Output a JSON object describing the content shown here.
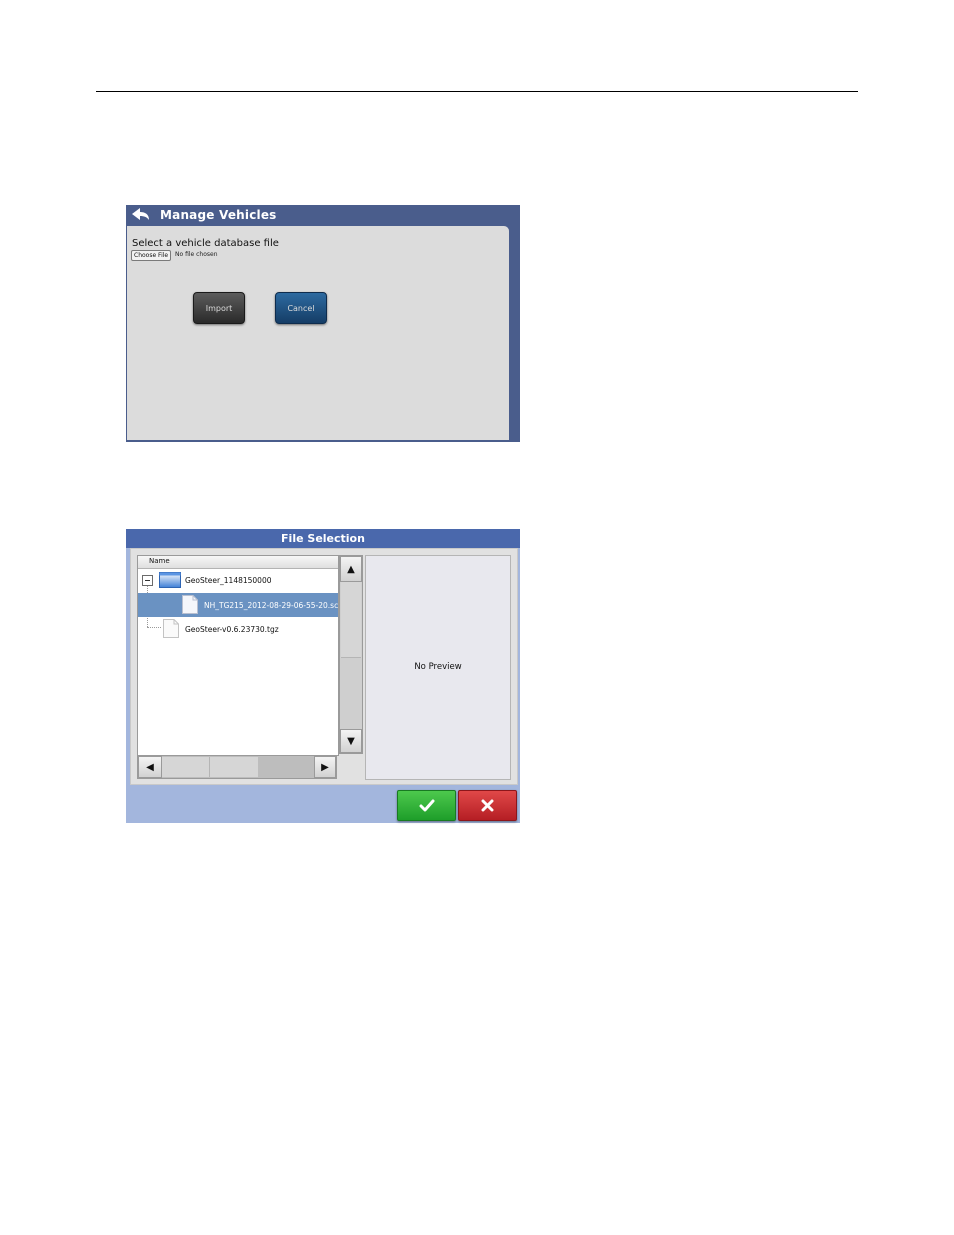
{
  "manage_vehicles": {
    "title": "Manage Vehicles",
    "prompt": "Select a vehicle database file",
    "choose_file_label": "Choose File",
    "file_status": "No file chosen",
    "import_label": "Import",
    "cancel_label": "Cancel",
    "icons": {
      "back": "back-arrow-icon"
    }
  },
  "file_selection": {
    "title": "File Selection",
    "column_header": "Name",
    "items": [
      {
        "label": "GeoSteer_1148150000",
        "type": "folder",
        "expanded": true
      },
      {
        "label": "NH_TG215_2012-08-29-06-55-20.sc",
        "type": "file",
        "selected": true
      },
      {
        "label": "GeoSteer-v0.6.23730.tgz",
        "type": "file",
        "selected": false
      }
    ],
    "preview_text": "No Preview",
    "icons": {
      "ok": "checkmark-icon",
      "cancel": "x-icon",
      "scroll_up": "arrow-up-icon",
      "scroll_down": "arrow-down-icon",
      "scroll_left": "arrow-left-icon",
      "scroll_right": "arrow-right-icon"
    }
  },
  "colors": {
    "title_bar": "#4a68ac",
    "dialog_bg": "#a3b6dd",
    "selection": "#6a92c2",
    "ok_green": "#1e9e2a",
    "cancel_red": "#b51e24",
    "cancel_blue": "#153d66"
  }
}
